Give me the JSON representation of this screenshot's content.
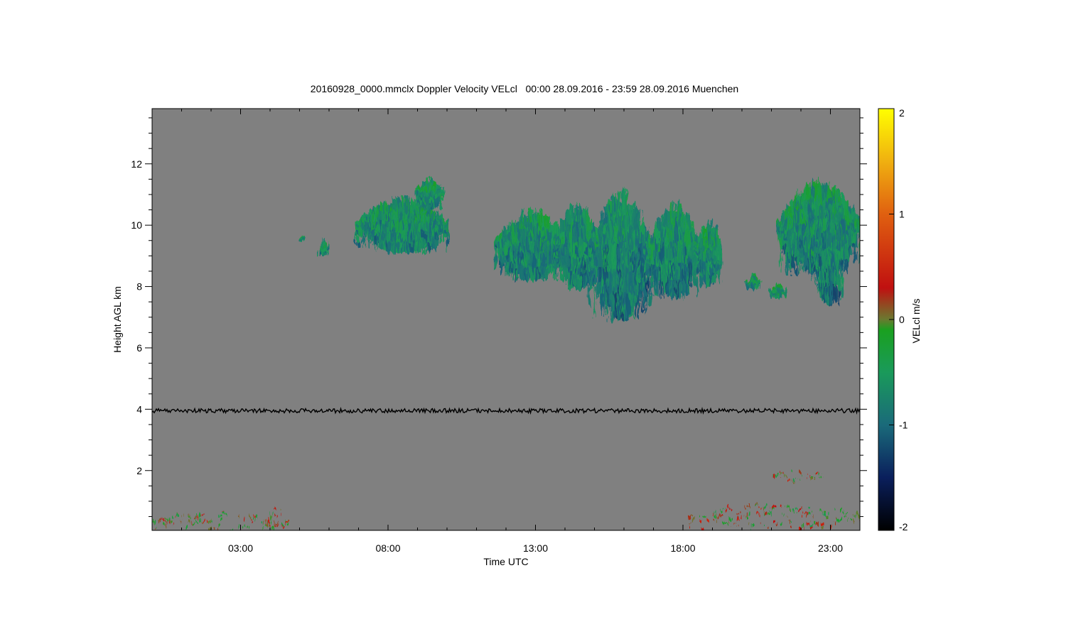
{
  "chart_data": {
    "type": "heatmap",
    "title": "20160928_0000.mmclx Doppler Velocity VELcl   00:00 28.09.2016 - 23:59 28.09.2016 Muenchen",
    "xlabel": "Time UTC",
    "ylabel": "Height AGL km",
    "xlim": [
      0,
      24
    ],
    "ylim": [
      0.05,
      13.8
    ],
    "x_ticks": [
      {
        "value": 3,
        "label": "03:00"
      },
      {
        "value": 8,
        "label": "08:00"
      },
      {
        "value": 13,
        "label": "13:00"
      },
      {
        "value": 18,
        "label": "18:00"
      },
      {
        "value": 23,
        "label": "23:00"
      }
    ],
    "y_ticks": [
      {
        "value": 2,
        "label": "2"
      },
      {
        "value": 4,
        "label": "4"
      },
      {
        "value": 6,
        "label": "6"
      },
      {
        "value": 8,
        "label": "8"
      },
      {
        "value": 10,
        "label": "10"
      },
      {
        "value": 12,
        "label": "12"
      }
    ],
    "background_color": "#808080",
    "colorbar": {
      "label": "VELcl m/s",
      "range": [
        -2,
        2
      ],
      "ticks": [
        {
          "value": 2,
          "label": "2"
        },
        {
          "value": 1,
          "label": "1"
        },
        {
          "value": 0,
          "label": "0"
        },
        {
          "value": -1,
          "label": "-1"
        },
        {
          "value": -2,
          "label": "-2"
        }
      ],
      "stops": [
        {
          "value": -2,
          "color": "#000000"
        },
        {
          "value": -1.5,
          "color": "#0a1f5c"
        },
        {
          "value": -1,
          "color": "#1a6a7a"
        },
        {
          "value": -0.5,
          "color": "#1a9a5a"
        },
        {
          "value": -0.1,
          "color": "#1aa020"
        },
        {
          "value": 0,
          "color": "#6a7a30"
        },
        {
          "value": 0.3,
          "color": "#c01010"
        },
        {
          "value": 1,
          "color": "#e06010"
        },
        {
          "value": 1.5,
          "color": "#f0b010"
        },
        {
          "value": 2,
          "color": "#ffff00"
        }
      ]
    },
    "regions": [
      {
        "name": "cirrus-0730",
        "x0": 6.9,
        "x1": 10.0,
        "bottom": 9.1,
        "top": 11.0,
        "v": -0.55
      },
      {
        "name": "cirrus-0930",
        "x0": 8.9,
        "x1": 9.9,
        "bottom": 10.5,
        "top": 11.6,
        "v": -0.5
      },
      {
        "name": "small-0500",
        "x0": 5.0,
        "x1": 5.1,
        "bottom": 9.5,
        "top": 9.65,
        "v": -0.6
      },
      {
        "name": "small-0550",
        "x0": 5.65,
        "x1": 5.95,
        "bottom": 9.0,
        "top": 9.6,
        "v": -0.5
      },
      {
        "name": "cirrus-1230",
        "x0": 11.6,
        "x1": 14.1,
        "bottom": 8.2,
        "top": 10.6,
        "v": -0.55
      },
      {
        "name": "cirrus-1300",
        "x0": 13.6,
        "x1": 15.2,
        "bottom": 7.9,
        "top": 10.8,
        "v": -0.6
      },
      {
        "name": "cirrus-1500",
        "x0": 14.8,
        "x1": 17.0,
        "bottom": 6.9,
        "top": 11.3,
        "v": -0.65
      },
      {
        "name": "cirrus-1630",
        "x0": 16.8,
        "x1": 18.6,
        "bottom": 7.6,
        "top": 10.9,
        "v": -0.6
      },
      {
        "name": "cirrus-1830",
        "x0": 18.4,
        "x1": 19.3,
        "bottom": 8.0,
        "top": 10.3,
        "v": -0.55
      },
      {
        "name": "patch-2030",
        "x0": 20.1,
        "x1": 20.6,
        "bottom": 7.9,
        "top": 8.4,
        "v": -0.45
      },
      {
        "name": "patch-2100",
        "x0": 20.9,
        "x1": 21.5,
        "bottom": 7.6,
        "top": 8.1,
        "v": -0.4
      },
      {
        "name": "cirrus-2200",
        "x0": 21.2,
        "x1": 24.0,
        "bottom": 8.4,
        "top": 11.6,
        "v": -0.55
      },
      {
        "name": "cirrus-2300",
        "x0": 22.4,
        "x1": 23.4,
        "bottom": 7.4,
        "top": 10.6,
        "v": -0.65
      },
      {
        "name": "boundary-0000",
        "x0": 0.0,
        "x1": 4.6,
        "bottom": 0.1,
        "top": 0.7,
        "v": -0.1
      },
      {
        "name": "boundary-0400",
        "x0": 3.8,
        "x1": 4.6,
        "bottom": 0.1,
        "top": 0.9,
        "v": -0.05
      },
      {
        "name": "boundary-1800",
        "x0": 18.2,
        "x1": 24.0,
        "bottom": 0.1,
        "top": 1.0,
        "v": -0.1
      },
      {
        "name": "patch-2200-low",
        "x0": 21.0,
        "x1": 22.7,
        "bottom": 1.7,
        "top": 2.1,
        "v": -0.1
      }
    ],
    "noise_line": {
      "height": 3.95,
      "color": "#000000"
    }
  }
}
